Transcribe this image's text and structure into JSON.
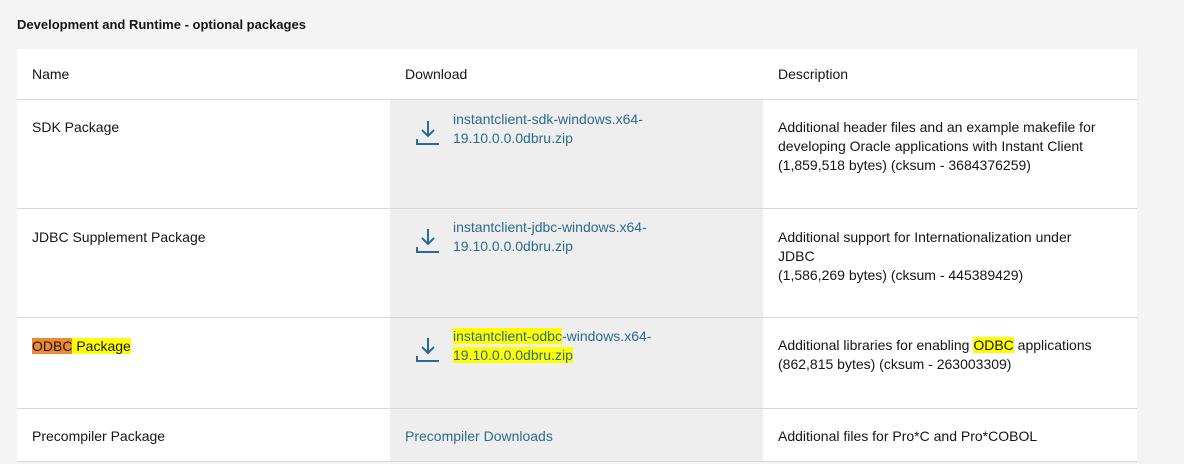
{
  "section_title": "Development and Runtime - optional packages",
  "table": {
    "headers": {
      "name": "Name",
      "download": "Download",
      "description": "Description"
    },
    "rows": [
      {
        "name": "SDK Package",
        "download_line1": "instantclient-sdk-windows.x64-",
        "download_line2": "19.10.0.0.0dbru.zip",
        "desc_line1": "Additional header files and an example makefile for",
        "desc_line2": "developing Oracle applications with Instant Client",
        "desc_line3": "(1,859,518 bytes) (cksum - 3684376259)"
      },
      {
        "name": "JDBC Supplement Package",
        "download_line1": "instantclient-jdbc-windows.x64-",
        "download_line2": "19.10.0.0.0dbru.zip",
        "desc_line1": "Additional support for Internationalization under",
        "desc_line2": "JDBC",
        "desc_line3": "(1,586,269 bytes) (cksum - 445389429)"
      },
      {
        "name_hl": "ODBC",
        "name_rest": " Package",
        "download_p1": "instantclient-",
        "download_hl": "odbc",
        "download_p2": "-windows.x64-",
        "download_line2": "19.10.0.0.0dbru.zip",
        "desc_p1": "Additional libraries for enabling ",
        "desc_hl": "ODBC",
        "desc_p2": " applications",
        "desc_line2": "(862,815 bytes) (cksum - 263003309)"
      },
      {
        "name": "Precompiler Package",
        "download_link": "Precompiler Downloads",
        "desc_line1": "Additional files for Pro*C and Pro*COBOL"
      }
    ]
  },
  "colors": {
    "link": "#2b6b8f",
    "highlight": "#ffff00",
    "highlight_current": "#f08a31"
  },
  "icons": {
    "download": "download-icon"
  }
}
